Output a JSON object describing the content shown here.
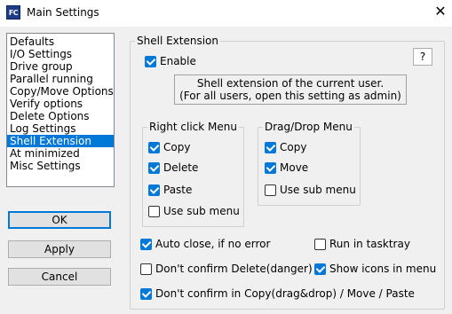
{
  "window": {
    "title": "Main Settings",
    "icon_text": "FC",
    "close_glyph": "✕"
  },
  "sidebar": {
    "items": [
      {
        "label": "Defaults",
        "selected": false
      },
      {
        "label": "I/O Settings",
        "selected": false
      },
      {
        "label": "Drive group",
        "selected": false
      },
      {
        "label": "Parallel running",
        "selected": false
      },
      {
        "label": "Copy/Move Options",
        "selected": false
      },
      {
        "label": "Verify options",
        "selected": false
      },
      {
        "label": "Delete Options",
        "selected": false
      },
      {
        "label": "Log Settings",
        "selected": false
      },
      {
        "label": "Shell Extension",
        "selected": true
      },
      {
        "label": "At minimized",
        "selected": false
      },
      {
        "label": "Misc Settings",
        "selected": false
      }
    ]
  },
  "buttons": {
    "ok": "OK",
    "apply": "Apply",
    "cancel": "Cancel"
  },
  "shell_extension": {
    "group_label": "Shell Extension",
    "enable_label": "Enable",
    "enable_checked": true,
    "help_label": "?",
    "info_line1": "Shell extension of the current user.",
    "info_line2": "(For all users, open this setting as admin)"
  },
  "right_click_menu": {
    "group_label": "Right click Menu",
    "copy": {
      "label": "Copy",
      "checked": true
    },
    "delete": {
      "label": "Delete",
      "checked": true
    },
    "paste": {
      "label": "Paste",
      "checked": true
    },
    "use_sub_menu": {
      "label": "Use sub menu",
      "checked": false
    }
  },
  "drag_drop_menu": {
    "group_label": "Drag/Drop Menu",
    "copy": {
      "label": "Copy",
      "checked": true
    },
    "move": {
      "label": "Move",
      "checked": true
    },
    "use_sub_menu": {
      "label": "Use sub menu",
      "checked": false
    }
  },
  "options": {
    "auto_close": {
      "label": "Auto close, if no error",
      "checked": true
    },
    "run_in_tasktray": {
      "label": "Run in tasktray",
      "checked": false
    },
    "dont_confirm_delete": {
      "label": "Don't confirm Delete(danger)",
      "checked": false
    },
    "show_icons_in_menu": {
      "label": "Show icons in menu",
      "checked": true
    },
    "dont_confirm_copy": {
      "label": "Don't confirm in Copy(drag&drop) / Move / Paste",
      "checked": true
    }
  },
  "colors": {
    "accent": "#0078d7",
    "window_bg": "#f0f0f0",
    "titlebar_bg": "#ffffff"
  }
}
